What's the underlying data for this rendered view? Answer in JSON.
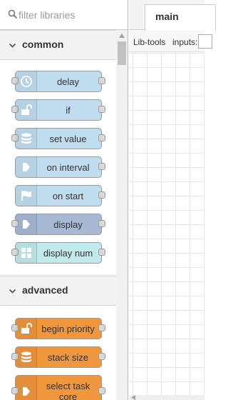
{
  "palette": {
    "filter": {
      "placeholder": "filter libraries",
      "value": ""
    },
    "sections": [
      {
        "label": "common",
        "expanded": true,
        "nodes": [
          {
            "label": "delay",
            "icon": "clock-icon",
            "color": "#c0ddef",
            "has_input": true,
            "has_output": true
          },
          {
            "label": "if",
            "icon": "unlock-icon",
            "color": "#c0ddef",
            "has_input": true,
            "has_output": true
          },
          {
            "label": "set value",
            "icon": "database-icon",
            "color": "#c0ddef",
            "has_input": true,
            "has_output": true
          },
          {
            "label": "on interval",
            "icon": "arrow-right-icon",
            "color": "#c0ddef",
            "has_input": false,
            "has_output": true
          },
          {
            "label": "on start",
            "icon": "flag-icon",
            "color": "#c0ddef",
            "has_input": false,
            "has_output": true
          },
          {
            "label": "display",
            "icon": "arrow-right-icon",
            "color": "#a7b9d4",
            "has_input": true,
            "has_output": true
          },
          {
            "label": "display num",
            "icon": "grid-icon",
            "color": "#c0eaec",
            "has_input": true,
            "has_output": true
          }
        ]
      },
      {
        "label": "advanced",
        "expanded": true,
        "nodes": [
          {
            "label": "begin priority",
            "icon": "unlock-icon",
            "color": "#f0963c",
            "has_input": true,
            "has_output": true
          },
          {
            "label": "stack size",
            "icon": "database-icon",
            "color": "#f0963c",
            "has_input": true,
            "has_output": true
          },
          {
            "label": "select task core",
            "icon": "arrow-right-icon",
            "color": "#f0963c",
            "has_input": true,
            "has_output": true
          }
        ]
      }
    ]
  },
  "workspace": {
    "tabs": [
      {
        "label": "main",
        "active": true
      }
    ],
    "toolbar": {
      "lib_label": "Lib-tools",
      "inputs_label": "inputs:",
      "inputs_value": ""
    }
  }
}
